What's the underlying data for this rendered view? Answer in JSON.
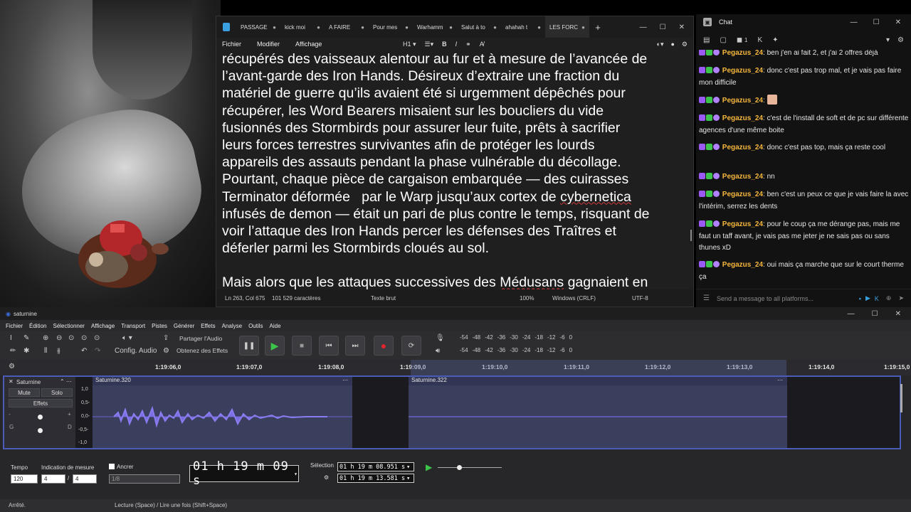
{
  "notepad": {
    "tabs": [
      {
        "label": "PASSAGE"
      },
      {
        "label": "kick moi"
      },
      {
        "label": "A FAIRE"
      },
      {
        "label": "Pour mes"
      },
      {
        "label": "Warhamm"
      },
      {
        "label": "Salut à to"
      },
      {
        "label": "ahahah t"
      },
      {
        "label": "LES FORC",
        "active": true
      }
    ],
    "new_tab": "+",
    "menu": [
      "Fichier",
      "Modifier",
      "Affichage"
    ],
    "heading_select": "H1",
    "paragraph1_lines": [
      "récupérés des vaisseaux alentour au fur et à mesure de l’avancée de",
      "l’avant-garde des Iron Hands. Désireux d’extraire une fraction du",
      "matériel de guerre qu’ils avaient été si urgemment dépêchés pour",
      "récupérer, les Word Bearers misaient sur les boucliers du vide",
      "fusionnés des Stormbirds pour assurer leur fuite, prêts à sacrifier",
      "leurs forces terrestres survivantes afin de protéger les lourds",
      "appareils des assauts pendant la phase vulnérable du décollage.",
      "Pourtant, chaque pièce de cargaison embarquée — des cuirasses"
    ],
    "line9_pre": "Terminator déformée   par le Warp jusqu’aux cortex de ",
    "line9_err": "cybernetica",
    "paragraph1_tail": [
      "infusés de demon — était un pari de plus contre le temps, risquant de",
      "voir l’attaque des Iron Hands percer les défenses des Traîtres et",
      "déferler parmi les Stormbirds cloués au sol."
    ],
    "para2_pre": "Mais alors que les attaques successives des ",
    "para2_err": "Médusans",
    "para2_post": " gagnaient en",
    "status": {
      "position": "Ln 263, Col 675",
      "chars": "101 529 caractères",
      "format": "Texte brut",
      "zoom": "100%",
      "eol": "Windows (CRLF)",
      "encoding": "UTF-8"
    }
  },
  "chat": {
    "title": "Chat",
    "viewer_count": "1",
    "messages": [
      {
        "user": "Pegazus_24",
        "text": ": ben j'en ai fait 2, et j'ai 2 offres déjà"
      },
      {
        "user": "Pegazus_24",
        "text": ": donc c'est pas trop mal, et je vais pas faire mon difficile"
      },
      {
        "user": "Pegazus_24",
        "text": ":",
        "emote": true
      },
      {
        "user": "Pegazus_24",
        "text": ": c'est de l'install de soft et de pc sur différente agences d'une même boite"
      },
      {
        "user": "Pegazus_24",
        "text": ": donc c'est pas top, mais ça reste cool"
      },
      {
        "user": "Pegazus_24",
        "text": ": nn"
      },
      {
        "user": "Pegazus_24",
        "text": ": ben c'est un peux ce que je vais faire la avec l'intérim, serrez les dents"
      },
      {
        "user": "Pegazus_24",
        "text": ": pour le coup ça me dérange pas, mais me faut un taff avant, je vais pas me jeter je ne sais pas ou sans thunes xD"
      },
      {
        "user": "Pegazus_24",
        "text": ": oui mais ça marche que sur le court therme ça"
      }
    ],
    "input_placeholder": "Send a message to all platforms..."
  },
  "audacity": {
    "title": "saturnine",
    "menu": [
      "Fichier",
      "Édition",
      "Sélectionner",
      "Affichage",
      "Transport",
      "Pistes",
      "Générer",
      "Effets",
      "Analyse",
      "Outils",
      "Aide"
    ],
    "audio_setup": "Config. Audio",
    "share_audio": "Partager l'Audio",
    "get_effects": "Obtenez des Effets",
    "meter_ticks": [
      "-54",
      "-48",
      "-42",
      "-36",
      "-30",
      "-24",
      "-18",
      "-12",
      "-6",
      "0"
    ],
    "ruler": [
      "1:19:06,0",
      "1:19:07,0",
      "1:19:08,0",
      "1:19:09,0",
      "1:19:10,0",
      "1:19:11,0",
      "1:19:12,0",
      "1:19:13,0",
      "1:19:14,0",
      "1:19:15,0"
    ],
    "track": {
      "name": "Saturnine",
      "mute": "Mute",
      "solo": "Solo",
      "effects": "Effets",
      "scale": [
        "1,0",
        "0,5-",
        "0,0-",
        "-0,5-",
        "-1,0"
      ],
      "clips": [
        "Saturnine.320",
        "Saturnine.322"
      ]
    },
    "tempo_label": "Tempo",
    "tempo": "120",
    "signature_label": "Indication de mesure",
    "sig_num": "4",
    "sig_den": "4",
    "snap_label": "Ancrer",
    "snap_value": "1/8",
    "time": "01 h 19 m 09 s",
    "selection_label": "Sélection",
    "sel_start": "01 h 19 m 08.951 s",
    "sel_end": "01 h 19 m 13.581 s",
    "status_left": "Arrêté.",
    "status_hint": "Lecture (Space) / Lire une fois (Shift+Space)"
  },
  "colors": {
    "accent": "#4a5cb8",
    "clip": "#3a3f5e",
    "waveform": "#7a6ee0",
    "username": "#f5b63c",
    "record": "#e0252d",
    "play": "#3cc44a"
  }
}
